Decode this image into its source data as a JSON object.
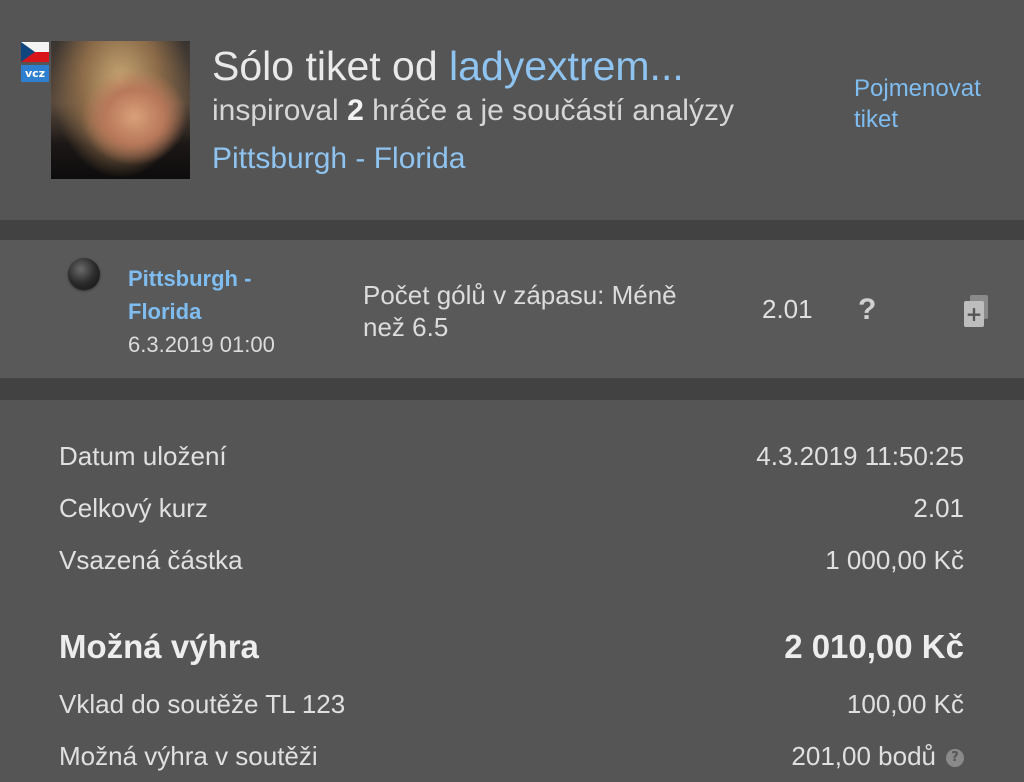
{
  "header": {
    "flag_badge": "vcz",
    "title_prefix": "Sólo tiket od ",
    "username": "ladyextrem...",
    "inspired_prefix": "inspiroval ",
    "inspired_count": "2",
    "inspired_suffix": " hráče a je součástí analýzy",
    "match": "Pittsburgh - Florida",
    "rename_link": "Pojmenovat tiket"
  },
  "bet": {
    "status_icon": "status-ball-icon",
    "event_name": "Pittsburgh - Florida",
    "event_datetime": "6.3.2019 01:00",
    "pick": "Počet gólů v zápasu: Méně než 6.5",
    "odd": "2.01",
    "help_symbol": "?",
    "add_symbol": "+"
  },
  "summary": {
    "saved_label": "Datum uložení",
    "saved_value": "4.3.2019 11:50:25",
    "total_odds_label": "Celkový kurz",
    "total_odds_value": "2.01",
    "stake_label": "Vsazená částka",
    "stake_value": "1 000,00 Kč",
    "possible_win_label": "Možná výhra",
    "possible_win_value": "2 010,00 Kč",
    "contest_stake_label": "Vklad do soutěže  TL 123",
    "contest_stake_value": "100,00 Kč",
    "contest_win_label": "Možná výhra v soutěži",
    "contest_win_value": "201,00  bodů",
    "contest_help_symbol": "?"
  },
  "colors": {
    "link": "#8fc3f0",
    "background": "#555555",
    "separator": "#424242"
  }
}
